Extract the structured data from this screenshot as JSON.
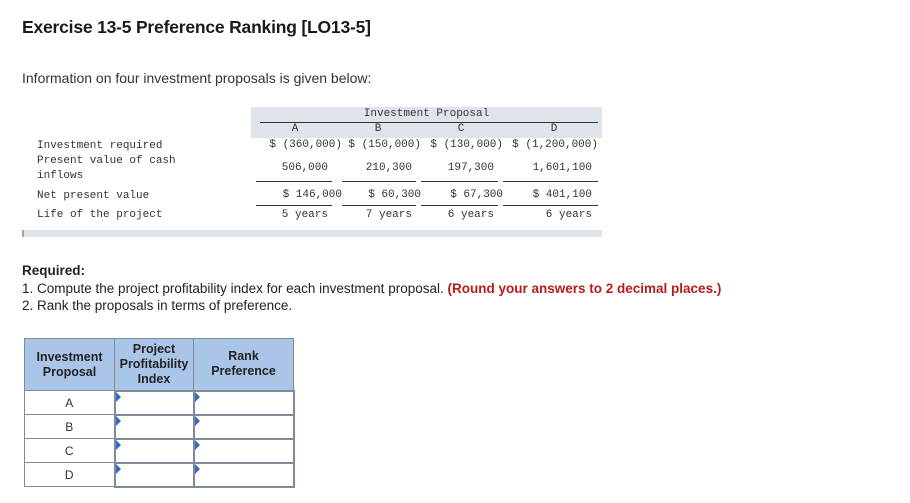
{
  "page": {
    "title": "Exercise 13-5 Preference Ranking [LO13-5]",
    "intro": "Information on four investment proposals is given below:"
  },
  "data_table": {
    "header_title": "Investment Proposal",
    "columns": [
      "A",
      "B",
      "C",
      "D"
    ],
    "rows": [
      {
        "label": "Investment required",
        "values": [
          "$ (360,000)",
          "$ (150,000)",
          "$ (130,000)",
          "$ (1,200,000)"
        ]
      },
      {
        "label_line1": "Present value of cash",
        "label_line2": "inflows",
        "values": [
          "506,000",
          "210,300",
          "197,300",
          "1,601,100"
        ]
      },
      {
        "label": "Net present value",
        "values": [
          "$  146,000",
          "$   60,300",
          "$   67,300",
          "$    401,100"
        ]
      },
      {
        "label": "Life of the project",
        "values": [
          "5 years",
          "7 years",
          "6 years",
          "6 years"
        ]
      }
    ]
  },
  "required": {
    "heading": "Required:",
    "item1": "1. Compute the project profitability index for each investment proposal.",
    "item1_note": "(Round your answers to 2 decimal places.)",
    "item2": "2. Rank the proposals in terms of preference."
  },
  "answer_table": {
    "col1_header_line1": "Investment",
    "col1_header_line2": "Proposal",
    "col2_header_line1": "Project",
    "col2_header_line2": "Profitability",
    "col2_header_line3": "Index",
    "col3_header_line1": "Rank",
    "col3_header_line2": "Preference",
    "rows": [
      {
        "proposal": "A",
        "index_value": "",
        "rank_value": ""
      },
      {
        "proposal": "B",
        "index_value": "",
        "rank_value": ""
      },
      {
        "proposal": "C",
        "index_value": "",
        "rank_value": ""
      },
      {
        "proposal": "D",
        "index_value": "",
        "rank_value": ""
      }
    ]
  }
}
